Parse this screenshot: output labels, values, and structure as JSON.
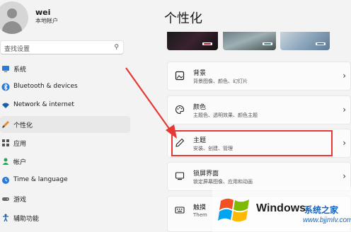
{
  "user": {
    "name": "wei",
    "account_type": "本地帐户"
  },
  "search": {
    "placeholder": "查找设置"
  },
  "sidebar": {
    "items": [
      {
        "label": "系统",
        "icon": "monitor-icon"
      },
      {
        "label": "Bluetooth & devices",
        "icon": "bluetooth-icon"
      },
      {
        "label": "Network & internet",
        "icon": "wifi-icon"
      },
      {
        "label": "个性化",
        "icon": "brush-icon",
        "active": true
      },
      {
        "label": "应用",
        "icon": "apps-icon"
      },
      {
        "label": "帐户",
        "icon": "person-icon"
      },
      {
        "label": "Time & language",
        "icon": "globe-clock-icon"
      },
      {
        "label": "游戏",
        "icon": "gamepad-icon"
      },
      {
        "label": "辅助功能",
        "icon": "accessibility-icon"
      }
    ]
  },
  "main": {
    "title": "个性化",
    "cards": [
      {
        "title": "背景",
        "subtitle": "背景图像、颜色、幻灯片",
        "icon": "image-icon"
      },
      {
        "title": "颜色",
        "subtitle": "主题色、透明效果、颜色主题",
        "icon": "palette-icon"
      },
      {
        "title": "主题",
        "subtitle": "安装、创建、管理",
        "icon": "pen-icon"
      },
      {
        "title": "锁屏界面",
        "subtitle": "锁定屏幕图像、应用和动画",
        "icon": "lockscreen-icon"
      },
      {
        "title": "触摸",
        "subtitle": "Them",
        "icon": "keyboard-icon"
      }
    ]
  },
  "watermark": {
    "title": "Windows",
    "cn": "系统之家",
    "url": "www.bjjmlv.com"
  },
  "colors": {
    "accent": "#0067c0",
    "highlight": "#e53935",
    "arrow": "#e53935"
  }
}
